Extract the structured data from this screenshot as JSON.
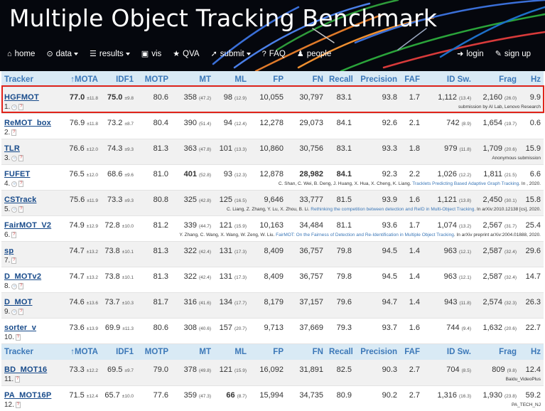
{
  "header": {
    "title": "Multiple Object Tracking Benchmark",
    "nav_left": [
      {
        "label": "home",
        "icon": "home-icon",
        "glyph": "⌂",
        "dropdown": false
      },
      {
        "label": "data",
        "icon": "data-icon",
        "glyph": "⊙",
        "dropdown": true
      },
      {
        "label": "results",
        "icon": "results-icon",
        "glyph": "☰",
        "dropdown": true
      },
      {
        "label": "vis",
        "icon": "film-icon",
        "glyph": "▣",
        "dropdown": false
      },
      {
        "label": "QVA",
        "icon": "star-icon",
        "glyph": "★",
        "dropdown": false
      },
      {
        "label": "submit",
        "icon": "submit-icon",
        "glyph": "➚",
        "dropdown": true
      },
      {
        "label": "FAQ",
        "icon": "question-icon",
        "glyph": "?",
        "dropdown": false
      },
      {
        "label": "people",
        "icon": "user-icon",
        "glyph": "♟",
        "dropdown": false
      }
    ],
    "nav_right": [
      {
        "label": "login",
        "icon": "login-icon",
        "glyph": "➜"
      },
      {
        "label": "sign up",
        "icon": "pencil-icon",
        "glyph": "✎"
      }
    ]
  },
  "table": {
    "columns": [
      "Tracker",
      "MOTA",
      "IDF1",
      "MOTP",
      "MT",
      "ML",
      "FP",
      "FN",
      "Recall",
      "Precision",
      "FAF",
      "ID Sw.",
      "Frag",
      "Hz"
    ],
    "sort_arrow": "🡑",
    "group1": [
      {
        "name": "HGFMOT",
        "rank": "1.",
        "icons": 2,
        "mota": "77.0",
        "mota_std": "±11.8",
        "idf1": "75.0",
        "idf1_std": "±9.8",
        "motp": "80.6",
        "mt": "358",
        "mt_pct": "(47.2)",
        "ml": "98",
        "ml_pct": "(12.9)",
        "fp": "10,055",
        "fn": "30,797",
        "recall": "83.1",
        "precision": "93.8",
        "faf": "1.7",
        "idsw": "1,112",
        "idsw_r": "(13.4)",
        "frag": "2,160",
        "frag_r": "(26.0)",
        "hz": "9.9",
        "bold": [
          "mota",
          "idf1"
        ],
        "cite": "submission by AI Lab, Lenovo Research",
        "link": ""
      },
      {
        "name": "ReMOT_box",
        "rank": "2.",
        "icons": 1,
        "mota": "76.9",
        "mota_std": "±11.8",
        "idf1": "73.2",
        "idf1_std": "±8.7",
        "motp": "80.4",
        "mt": "390",
        "mt_pct": "(51.4)",
        "ml": "94",
        "ml_pct": "(12.4)",
        "fp": "12,278",
        "fn": "29,073",
        "recall": "84.1",
        "precision": "92.6",
        "faf": "2.1",
        "idsw": "742",
        "idsw_r": "(8.9)",
        "frag": "1,654",
        "frag_r": "(19.7)",
        "hz": "0.6",
        "bold": [],
        "cite": "",
        "link": ""
      },
      {
        "name": "TLR",
        "rank": "3.",
        "icons": 2,
        "mota": "76.6",
        "mota_std": "±12.0",
        "idf1": "74.3",
        "idf1_std": "±9.3",
        "motp": "81.3",
        "mt": "363",
        "mt_pct": "(47.8)",
        "ml": "101",
        "ml_pct": "(13.3)",
        "fp": "10,860",
        "fn": "30,756",
        "recall": "83.1",
        "precision": "93.3",
        "faf": "1.8",
        "idsw": "979",
        "idsw_r": "(11.8)",
        "frag": "1,709",
        "frag_r": "(20.6)",
        "hz": "15.9",
        "bold": [],
        "cite": "Anonymous submission",
        "link": ""
      },
      {
        "name": "FUFET",
        "rank": "4.",
        "icons": 2,
        "mota": "76.5",
        "mota_std": "±12.0",
        "idf1": "68.6",
        "idf1_std": "±9.6",
        "motp": "81.0",
        "mt": "401",
        "mt_pct": "(52.8)",
        "ml": "93",
        "ml_pct": "(12.3)",
        "fp": "12,878",
        "fn": "28,982",
        "recall": "84.1",
        "precision": "92.3",
        "faf": "2.2",
        "idsw": "1,026",
        "idsw_r": "(12.2)",
        "frag": "1,811",
        "frag_r": "(21.5)",
        "hz": "6.6",
        "bold": [
          "mt",
          "fn",
          "recall"
        ],
        "cite": "C. Shan, C. Wei, B. Deng, J. Huang, X. Hua, X. Cheng, K. Liang.",
        "link": "Tracklets Predicting Based Adaptive Graph Tracking",
        "cite_tail": ". In , 2020."
      },
      {
        "name": "CSTrack",
        "rank": "5.",
        "icons": 2,
        "mota": "75.6",
        "mota_std": "±11.9",
        "idf1": "73.3",
        "idf1_std": "±9.3",
        "motp": "80.8",
        "mt": "325",
        "mt_pct": "(42.8)",
        "ml": "125",
        "ml_pct": "(16.5)",
        "fp": "9,646",
        "fn": "33,777",
        "recall": "81.5",
        "precision": "93.9",
        "faf": "1.6",
        "idsw": "1,121",
        "idsw_r": "(13.8)",
        "frag": "2,450",
        "frag_r": "(30.1)",
        "hz": "15.8",
        "bold": [],
        "cite": "C. Liang, Z. Zhang, Y. Lu, X. Zhou, B. Li.",
        "link": "Rethinking the competition between detection and ReID in Multi-Object Tracking",
        "cite_tail": ". In arXiv:2010.12138 [cs], 2020."
      },
      {
        "name": "FairMOT_V2",
        "rank": "6.",
        "icons": 1,
        "mota": "74.9",
        "mota_std": "±12.9",
        "idf1": "72.8",
        "idf1_std": "±10.0",
        "motp": "81.2",
        "mt": "339",
        "mt_pct": "(44.7)",
        "ml": "121",
        "ml_pct": "(15.9)",
        "fp": "10,163",
        "fn": "34,484",
        "recall": "81.1",
        "precision": "93.6",
        "faf": "1.7",
        "idsw": "1,074",
        "idsw_r": "(13.2)",
        "frag": "2,567",
        "frag_r": "(31.7)",
        "hz": "25.4",
        "bold": [],
        "cite": "Y. Zhang, C. Wang, X. Wang, W. Zeng, W. Liu.",
        "link": "FairMOT: On the Fairness of Detection and Re-Identification in Multiple Object Tracking",
        "cite_tail": ". In arXiv preprint arXiv:2004.01888, 2020."
      },
      {
        "name": "sp",
        "rank": "7.",
        "icons": 1,
        "mota": "74.7",
        "mota_std": "±13.2",
        "idf1": "73.8",
        "idf1_std": "±10.1",
        "motp": "81.3",
        "mt": "322",
        "mt_pct": "(42.4)",
        "ml": "131",
        "ml_pct": "(17.3)",
        "fp": "8,409",
        "fn": "36,757",
        "recall": "79.8",
        "precision": "94.5",
        "faf": "1.4",
        "idsw": "963",
        "idsw_r": "(12.1)",
        "frag": "2,587",
        "frag_r": "(32.4)",
        "hz": "29.6",
        "bold": [],
        "cite": "",
        "link": ""
      },
      {
        "name": "D_MOTv2",
        "rank": "8.",
        "icons": 2,
        "mota": "74.7",
        "mota_std": "±13.2",
        "idf1": "73.8",
        "idf1_std": "±10.1",
        "motp": "81.3",
        "mt": "322",
        "mt_pct": "(42.4)",
        "ml": "131",
        "ml_pct": "(17.3)",
        "fp": "8,409",
        "fn": "36,757",
        "recall": "79.8",
        "precision": "94.5",
        "faf": "1.4",
        "idsw": "963",
        "idsw_r": "(12.1)",
        "frag": "2,587",
        "frag_r": "(32.4)",
        "hz": "14.7",
        "bold": [],
        "cite": "",
        "link": ""
      },
      {
        "name": "D_MOT",
        "rank": "9.",
        "icons": 2,
        "mota": "74.6",
        "mota_std": "±13.6",
        "idf1": "73.7",
        "idf1_std": "±10.3",
        "motp": "81.7",
        "mt": "316",
        "mt_pct": "(41.6)",
        "ml": "134",
        "ml_pct": "(17.7)",
        "fp": "8,179",
        "fn": "37,157",
        "recall": "79.6",
        "precision": "94.7",
        "faf": "1.4",
        "idsw": "943",
        "idsw_r": "(11.8)",
        "frag": "2,574",
        "frag_r": "(32.3)",
        "hz": "26.3",
        "bold": [],
        "cite": "",
        "link": ""
      },
      {
        "name": "sorter_v",
        "rank": "10.",
        "icons": 1,
        "mota": "73.6",
        "mota_std": "±13.9",
        "idf1": "69.9",
        "idf1_std": "±11.3",
        "motp": "80.6",
        "mt": "308",
        "mt_pct": "(40.6)",
        "ml": "157",
        "ml_pct": "(20.7)",
        "fp": "9,713",
        "fn": "37,669",
        "recall": "79.3",
        "precision": "93.7",
        "faf": "1.6",
        "idsw": "744",
        "idsw_r": "(9.4)",
        "frag": "1,632",
        "frag_r": "(20.6)",
        "hz": "22.7",
        "bold": [],
        "cite": "",
        "link": ""
      }
    ],
    "group2": [
      {
        "name": "BD_MOT16",
        "rank": "11.",
        "icons": 1,
        "mota": "73.3",
        "mota_std": "±12.2",
        "idf1": "69.5",
        "idf1_std": "±9.7",
        "motp": "79.0",
        "mt": "378",
        "mt_pct": "(49.8)",
        "ml": "121",
        "ml_pct": "(15.9)",
        "fp": "16,092",
        "fn": "31,891",
        "recall": "82.5",
        "precision": "90.3",
        "faf": "2.7",
        "idsw": "704",
        "idsw_r": "(8.5)",
        "frag": "809",
        "frag_r": "(9.8)",
        "hz": "12.4",
        "bold": [],
        "cite": "Baidu_VideoPlus",
        "link": ""
      },
      {
        "name": "PA_MOT16P",
        "rank": "12.",
        "icons": 1,
        "mota": "71.5",
        "mota_std": "±12.4",
        "idf1": "65.7",
        "idf1_std": "±10.0",
        "motp": "77.6",
        "mt": "359",
        "mt_pct": "(47.3)",
        "ml": "66",
        "ml_pct": "(8.7)",
        "fp": "15,994",
        "fn": "34,735",
        "recall": "80.9",
        "precision": "90.2",
        "faf": "2.7",
        "idsw": "1,316",
        "idsw_r": "(16.3)",
        "frag": "1,930",
        "frag_r": "(23.8)",
        "hz": "59.2",
        "bold": [
          "ml"
        ],
        "cite": "PA_TECH_NJ",
        "link": ""
      }
    ]
  }
}
